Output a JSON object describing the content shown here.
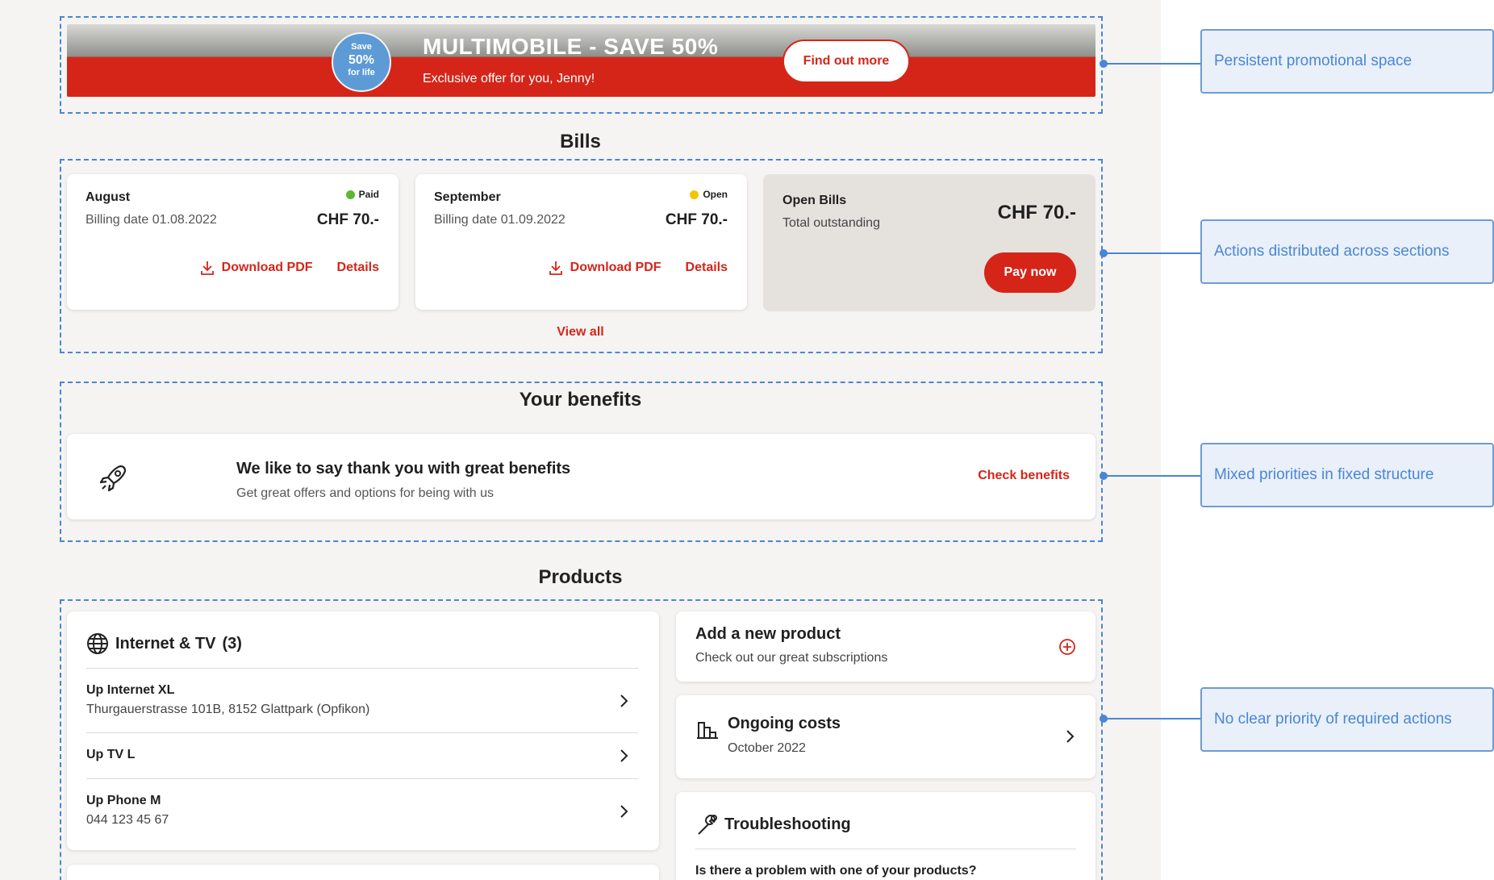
{
  "promo": {
    "sticker_top": "Save",
    "sticker_main": "50%",
    "sticker_bottom": "for life",
    "title": "MULTIMOBILE - SAVE 50%",
    "subtitle": "Exclusive offer for you, Jenny!",
    "button": "Find out more"
  },
  "bills": {
    "title": "Bills",
    "cards": [
      {
        "month": "August",
        "date": "Billing date 01.08.2022",
        "status": "Paid",
        "status_color": "#5cb82f",
        "amount": "CHF 70.-",
        "download": "Download PDF",
        "details": "Details"
      },
      {
        "month": "September",
        "date": "Billing date 01.09.2022",
        "status": "Open",
        "status_color": "#f2c500",
        "amount": "CHF 70.-",
        "download": "Download PDF",
        "details": "Details"
      }
    ],
    "open": {
      "title": "Open Bills",
      "subtitle": "Total outstanding",
      "amount": "CHF 70.-",
      "button": "Pay now"
    },
    "view_all": "View all"
  },
  "benefits": {
    "title": "Your benefits",
    "card_title": "We like to say thank you with great benefits",
    "card_sub": "Get great offers and options for being with us",
    "link": "Check benefits",
    "icon": "rocket-icon"
  },
  "products": {
    "title": "Products",
    "group_label": "Internet & TV",
    "group_count": "(3)",
    "items": [
      {
        "name": "Up Internet XL",
        "detail": "Thurgauerstrasse 101B, 8152 Glattpark (Opfikon)"
      },
      {
        "name": "Up TV L",
        "detail": ""
      },
      {
        "name": "Up Phone M",
        "detail": "044 123 45 67"
      }
    ],
    "add": {
      "title": "Add a new product",
      "sub": "Check out our great subscriptions"
    },
    "costs": {
      "title": "Ongoing costs",
      "sub": "October 2022"
    },
    "trouble": {
      "title": "Troubleshooting",
      "question": "Is there a problem with one of your products?"
    }
  },
  "annotations": [
    "Persistent promotional space",
    "Actions distributed across sections",
    "Mixed priorities in fixed structure",
    "No clear priority of required actions"
  ],
  "colors": {
    "accent": "#d52519",
    "annotation": "#4a86d4",
    "background": "#f5f4f2"
  }
}
